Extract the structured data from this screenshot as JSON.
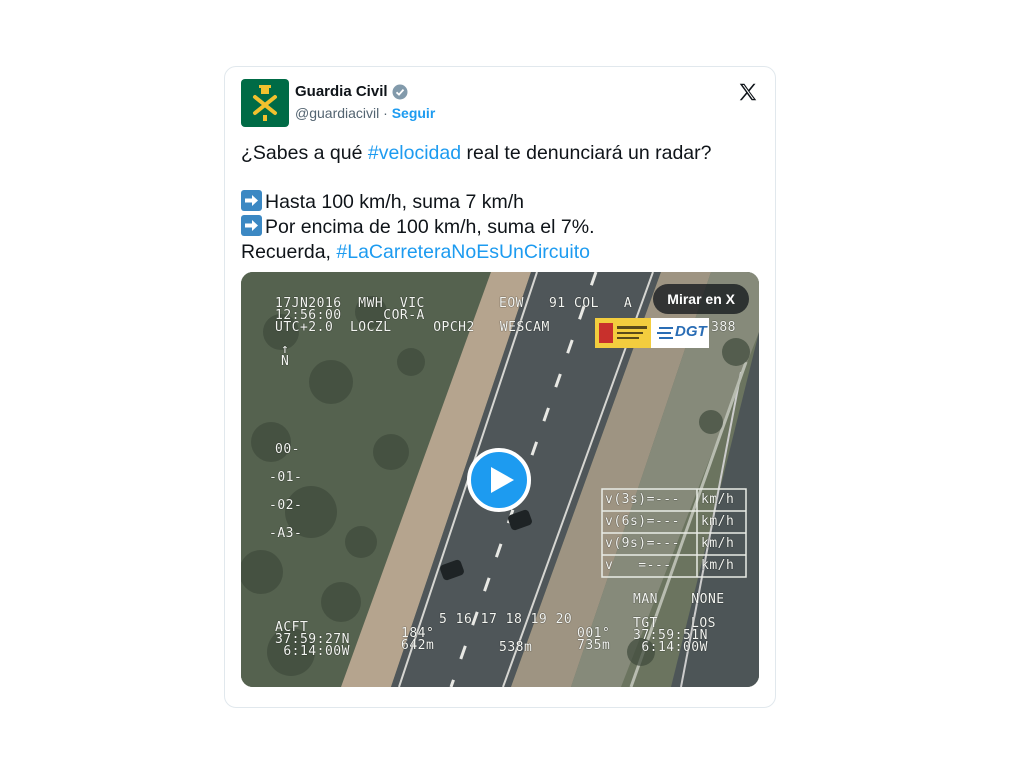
{
  "account": {
    "name": "Guardia Civil",
    "handle": "@guardiacivil",
    "separator": "·",
    "follow_label": "Seguir"
  },
  "tweet": {
    "line1_pre": "¿Sabes a qué ",
    "line1_tag": "#velocidad",
    "line1_post": " real te denunciará un radar?",
    "line2": "Hasta 100 km/h, suma 7 km/h",
    "line3": "Por encima de 100 km/h, suma el 7%.",
    "line4_pre": "Recuerda, ",
    "line4_tag": "#LaCarreteraNoEsUnCircuito"
  },
  "media": {
    "watch_label": "Mirar en X",
    "osd_top_left": "17JN2016  MWH  VIC\n12:56:00     COR-A\nUTC+2.0  LOCZL     OPCH2   WESCAM",
    "osd_top_mid": "EOW   91 COL   A",
    "osd_right_num": "388",
    "osd_north": "↑\nN",
    "osd_scale": [
      "00-",
      "-01-",
      "-02-",
      "-A3-"
    ],
    "osd_bottom_scale": "5 16 17 18 19 20",
    "osd_acft": "ACFT\n37:59:27N\n 6:14:00W",
    "osd_hdg": "184°\n642m",
    "osd_dist": "538m",
    "osd_tgt_angle": "001°\n735m",
    "osd_tgt": "TGT\n37:59:51N\n 6:14:00W",
    "osd_man_none": "MAN    NONE",
    "osd_los": "LOS",
    "speed_rows": [
      {
        "label": "v(3s)=---",
        "unit": "km/h"
      },
      {
        "label": "v(6s)=---",
        "unit": "km/h"
      },
      {
        "label": "v(9s)=---",
        "unit": "km/h"
      },
      {
        "label": "v   =---",
        "unit": "km/h"
      }
    ],
    "logo_dgt": "DGT"
  },
  "colors": {
    "link": "#1d9bf0",
    "avatar_bg": "#006b46"
  }
}
